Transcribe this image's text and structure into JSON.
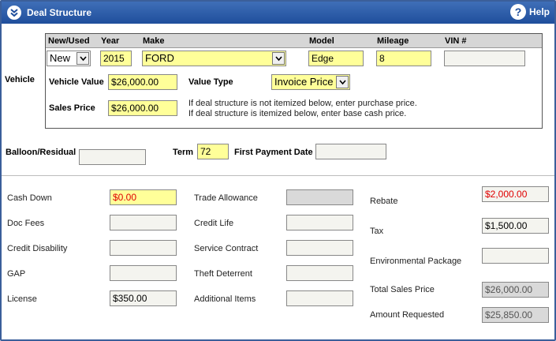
{
  "window": {
    "title": "Deal Structure",
    "help_label": "Help"
  },
  "vehicle": {
    "section_label": "Vehicle",
    "headers": {
      "new_used": "New/Used",
      "year": "Year",
      "make": "Make",
      "model": "Model",
      "mileage": "Mileage",
      "vin": "VIN #"
    },
    "new_used": "New",
    "year": "2015",
    "make": "FORD",
    "model": "Edge",
    "mileage": "8",
    "vin": "",
    "vehicle_value_label": "Vehicle Value",
    "vehicle_value": "$26,000.00",
    "value_type_label": "Value Type",
    "value_type": "Invoice Price",
    "sales_price_label": "Sales Price",
    "sales_price": "$26,000.00",
    "helper_line1": "If deal structure is not itemized below, enter purchase price.",
    "helper_line2": "If deal structure is itemized below, enter base cash price."
  },
  "terms": {
    "balloon_label": "Balloon/Residual",
    "balloon": "",
    "term_label": "Term",
    "term": "72",
    "first_payment_label": "First Payment Date",
    "first_payment": ""
  },
  "itemized": {
    "cash_down_label": "Cash Down",
    "cash_down": "$0.00",
    "doc_fees_label": "Doc Fees",
    "doc_fees": "",
    "credit_disability_label": "Credit Disability",
    "credit_disability": "",
    "gap_label": "GAP",
    "gap": "",
    "license_label": "License",
    "license": "$350.00",
    "trade_allowance_label": "Trade Allowance",
    "trade_allowance": "",
    "credit_life_label": "Credit Life",
    "credit_life": "",
    "service_contract_label": "Service Contract",
    "service_contract": "",
    "theft_deterrent_label": "Theft Deterrent",
    "theft_deterrent": "",
    "additional_items_label": "Additional Items",
    "additional_items": "",
    "rebate_label": "Rebate",
    "rebate": "$2,000.00",
    "tax_label": "Tax",
    "tax": "$1,500.00",
    "environmental_label": "Environmental Package",
    "environmental": "",
    "total_sales_label": "Total Sales Price",
    "total_sales": "$26,000.00",
    "amount_requested_label": "Amount Requested",
    "amount_requested": "$25,850.00"
  },
  "colors": {
    "titlebar": "#1f4e9c",
    "required_field": "#ffff99",
    "negative_value": "#e00000"
  }
}
